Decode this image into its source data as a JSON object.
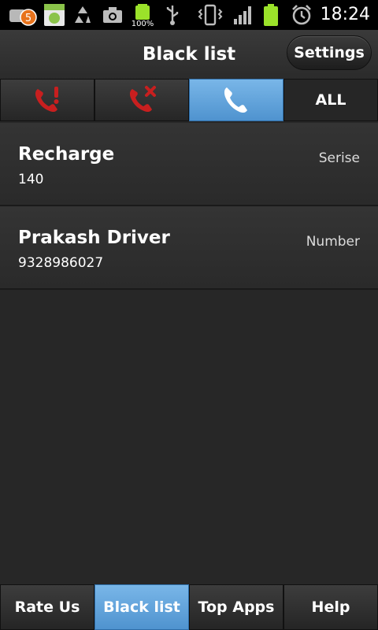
{
  "status_bar": {
    "time": "18:24",
    "notification_count": "5",
    "battery_percent": "100%",
    "icons": [
      "notification-badge-icon",
      "android-market-icon",
      "recycle-icon",
      "camera-icon",
      "battery-100-icon",
      "usb-icon",
      "vibrate-icon",
      "signal-icon",
      "battery-icon",
      "alarm-icon"
    ]
  },
  "header": {
    "title": "Black list",
    "settings_label": "Settings"
  },
  "filter_tabs": [
    {
      "icon": "missed-call-alert-icon",
      "active": false
    },
    {
      "icon": "rejected-call-icon",
      "active": false
    },
    {
      "icon": "phone-icon",
      "active": true
    },
    {
      "label": "ALL",
      "active": false
    }
  ],
  "entries": [
    {
      "name": "Recharge",
      "number": "140",
      "type": "Serise"
    },
    {
      "name": "Prakash Driver",
      "number": "9328986027",
      "type": "Number"
    }
  ],
  "bottom_nav": {
    "items": [
      "Rate Us",
      "Black list",
      "Top Apps",
      "Help"
    ],
    "active_index": 1
  },
  "colors": {
    "accent": "#5fa2dc",
    "call_icon_red": "#d42b2b",
    "background": "#272727"
  }
}
